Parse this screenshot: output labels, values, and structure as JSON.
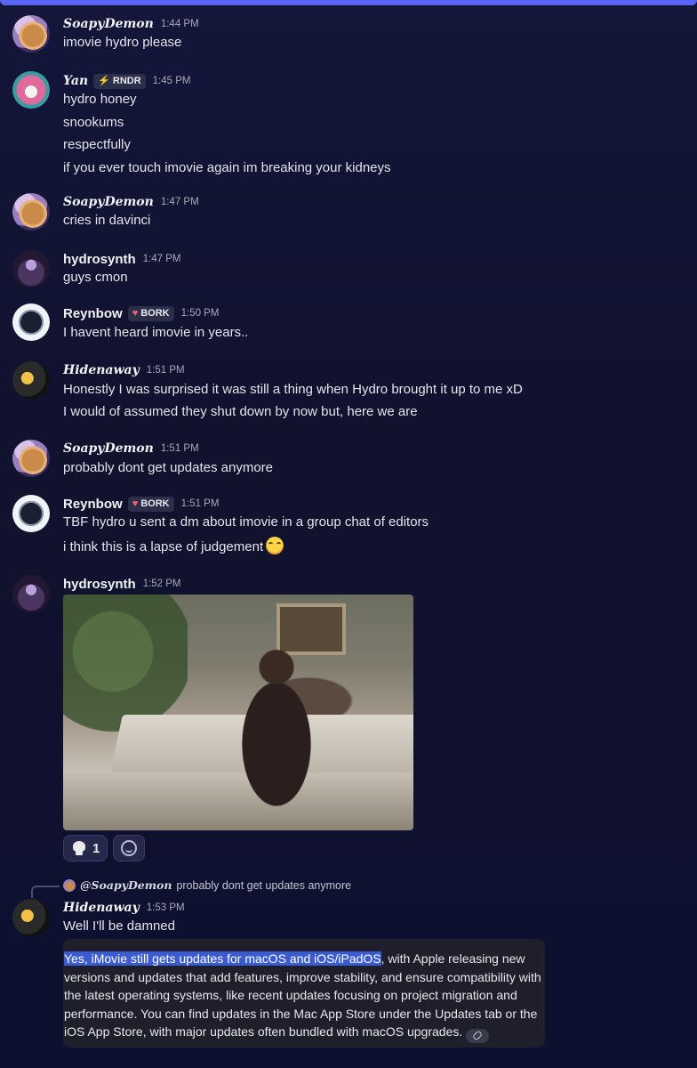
{
  "messages": [
    {
      "username": "SoapyDemon",
      "time": "1:44 PM",
      "lines": [
        "imovie hydro please"
      ]
    },
    {
      "username": "Yan",
      "tag": "RNDR",
      "time": "1:45 PM",
      "lines": [
        "hydro honey",
        "snookums",
        "respectfully",
        "if you ever touch imovie again im breaking your kidneys"
      ]
    },
    {
      "username": "SoapyDemon",
      "time": "1:47 PM",
      "lines": [
        "cries in davinci"
      ]
    },
    {
      "username": "hydrosynth",
      "time": "1:47 PM",
      "lines": [
        "guys cmon"
      ]
    },
    {
      "username": "Reynbow",
      "tag": "BORK",
      "time": "1:50 PM",
      "lines": [
        "I havent heard imovie in years.."
      ]
    },
    {
      "username": "Hidenaway",
      "time": "1:51 PM",
      "lines": [
        "Honestly I was surprised it was still a thing when Hydro brought it up to me xD",
        "I would of assumed they shut down by now but, here we are"
      ]
    },
    {
      "username": "SoapyDemon",
      "time": "1:51 PM",
      "lines": [
        "probably dont get updates anymore"
      ]
    },
    {
      "username": "Reynbow",
      "tag": "BORK",
      "time": "1:51 PM",
      "lines": [
        "TBF hydro u sent a dm about imovie in a group chat of editors",
        "i think this is a lapse of judgement"
      ]
    },
    {
      "username": "hydrosynth",
      "time": "1:52 PM",
      "reaction_count": "1"
    },
    {
      "username": "Hidenaway",
      "time": "1:53 PM",
      "reply_to_user": "@SoapyDemon",
      "reply_to_text": "probably dont get updates anymore",
      "lines": [
        "Well I'll be damned"
      ]
    }
  ],
  "embed": {
    "highlight": "Yes, iMovie still gets updates for macOS and iOS/iPadOS",
    "line1_rest": ", with Apple releasing new",
    "line2": "versions and updates that add features, improve stability, and ensure compatibility with",
    "line3": "the latest operating systems, like recent updates focusing on project migration and",
    "line4": "performance. You can find updates in the Mac App Store under the Updates tab or the",
    "line5": "iOS App Store, with major updates often bundled with macOS upgrades."
  },
  "icons": {
    "reaction_emoji": "skull-icon",
    "add_reaction": "smile-icon",
    "embed_link": "link-icon",
    "laugh_emoji": "tears-of-joy-emoji",
    "bork_tag_icon": "heart-icon",
    "rndr_tag_icon": "lightning-icon"
  },
  "colors": {
    "accent": "#5865f2",
    "highlight": "#3b5bd0",
    "background": "#10122e"
  }
}
